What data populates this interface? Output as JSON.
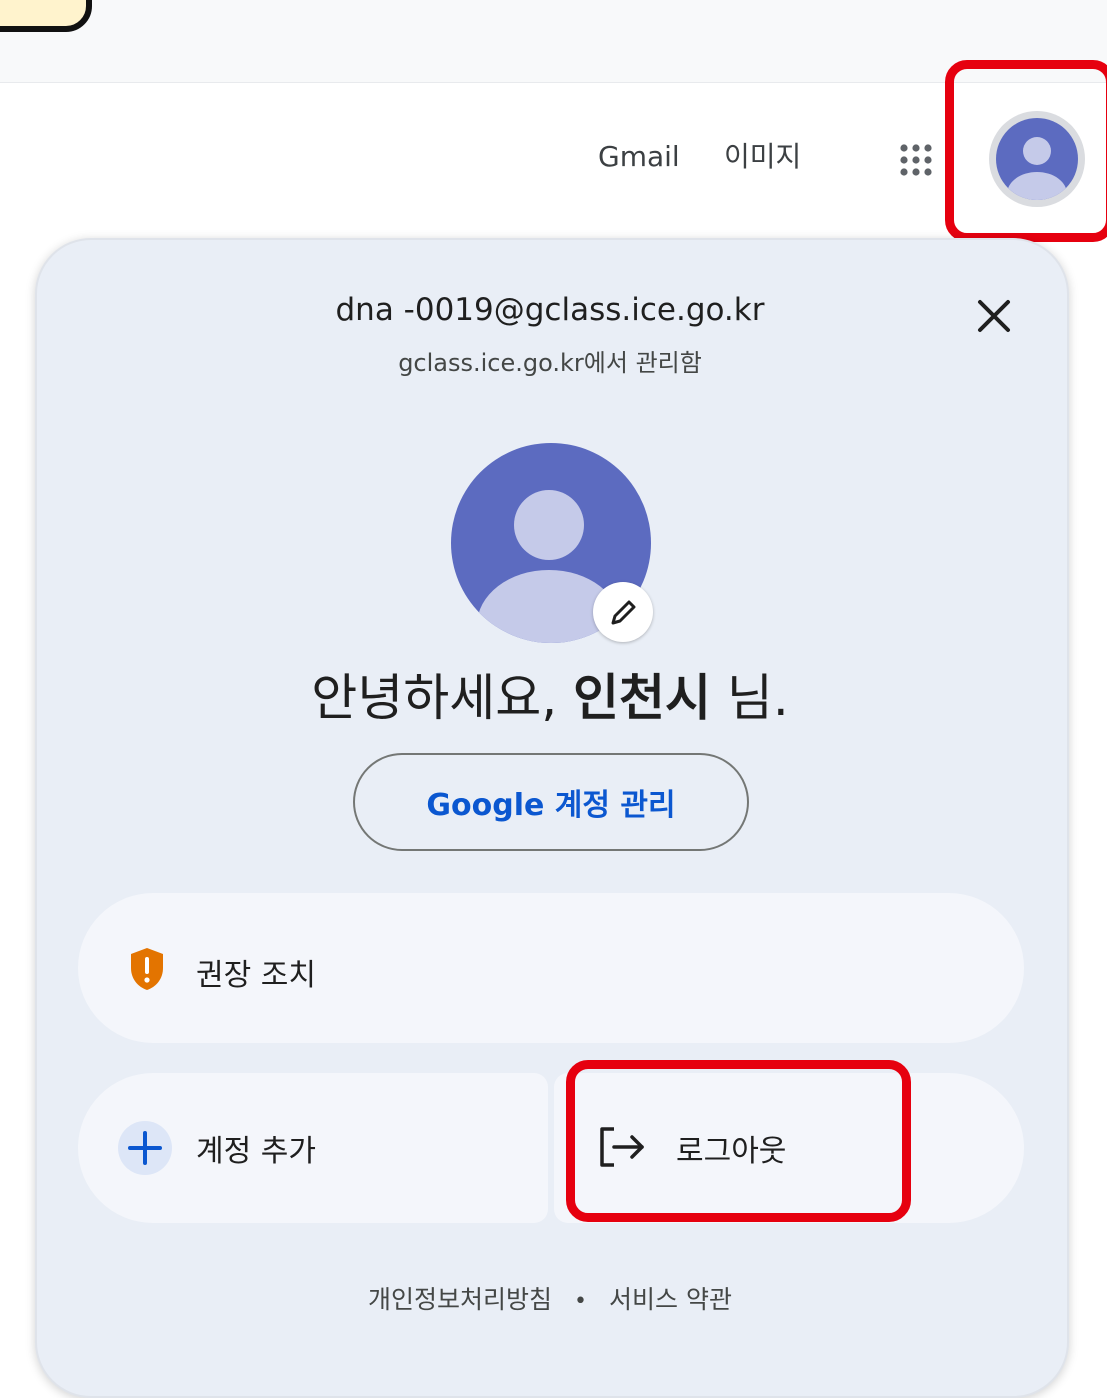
{
  "header": {
    "gmail_label": "Gmail",
    "images_label": "이미지"
  },
  "account_menu": {
    "email": "dna -0019@gclass.ice.go.kr",
    "managed_by": "gclass.ice.go.kr에서 관리함",
    "greeting_prefix": "안녕하세요, ",
    "user_name": "인천시",
    "greeting_suffix": " 님.",
    "manage_account_label": "Google 계정 관리",
    "recommended_actions_label": "권장 조치",
    "add_account_label": "계정 추가",
    "sign_out_label": "로그아웃",
    "privacy_policy_label": "개인정보처리방침",
    "terms_label": "서비스 약관"
  },
  "colors": {
    "avatar": "#5c6bc0",
    "avatar_figure": "#c5cae9",
    "accent_blue": "#0b57d0",
    "warning": "#e37400",
    "highlight": "#e6000f",
    "panel_bg": "#e9eef6"
  },
  "icons": {
    "apps": "apps-grid-icon",
    "close": "close-icon",
    "edit": "pencil-icon",
    "warning": "shield-exclamation-icon",
    "add": "plus-icon",
    "sign_out": "logout-icon"
  }
}
